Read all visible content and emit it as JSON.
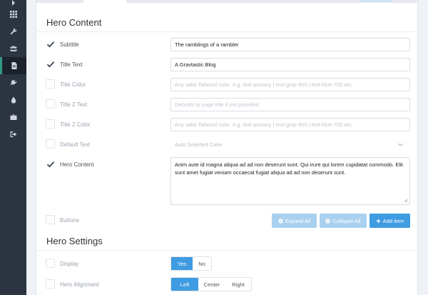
{
  "nav": {
    "items": [
      {
        "icon": "partial-arrow-icon"
      },
      {
        "icon": "grid-icon"
      },
      {
        "icon": "wrench-icon"
      },
      {
        "icon": "users-icon"
      },
      {
        "icon": "document-icon",
        "active": true
      },
      {
        "icon": "plug-icon"
      },
      {
        "icon": "droplet-icon"
      },
      {
        "icon": "briefcase-icon"
      },
      {
        "icon": "sign-out-icon"
      }
    ]
  },
  "hero_content": {
    "title": "Hero Content",
    "rows": [
      {
        "label": "Subtitle",
        "checked": true,
        "value": "The ramblings of a rambler"
      },
      {
        "label": "Title Text",
        "checked": true,
        "value": "A Gravtastic Blog"
      },
      {
        "label": "Title Color",
        "checked": false,
        "placeholder": "Any valid Tailwind color, e.g. text-primary | text-gray-800 | text-blue-700 etc"
      },
      {
        "label": "Title 2 Text",
        "checked": false,
        "placeholder": "Defaults to page title if not provided"
      },
      {
        "label": "Title 2 Color",
        "checked": false,
        "placeholder": "Any valid Tailwind color, e.g. text-primary | text-gray-800 | text-blue-700 etc"
      },
      {
        "label": "Default Text",
        "checked": false,
        "select_value": "Auto Selected Color"
      },
      {
        "label": "Hero Content",
        "checked": true,
        "text": "Anim aute id magna aliqua ad ad non deserunt sunt. Qui irure qui lorem cupidatat commodo. Elit sunt amet fugiat veniam occaecat fugiat aliqua ad ad non deserunt sunt."
      },
      {
        "label": "Buttons",
        "checked": false
      }
    ],
    "buttons": {
      "expand_all": "Expand All",
      "collapse_all": "Collapse All",
      "add_item": "Add item"
    }
  },
  "hero_settings": {
    "title": "Hero Settings",
    "display": {
      "label": "Display",
      "options": [
        "Yes",
        "No"
      ],
      "selected": "Yes"
    },
    "alignment": {
      "label": "Hero Alignment",
      "options": [
        "Left",
        "Center",
        "Right"
      ],
      "selected": "Left"
    }
  },
  "colors": {
    "rail": "#2b3440",
    "accent": "#3f9be2",
    "accent_light": "#a9d0ee"
  }
}
